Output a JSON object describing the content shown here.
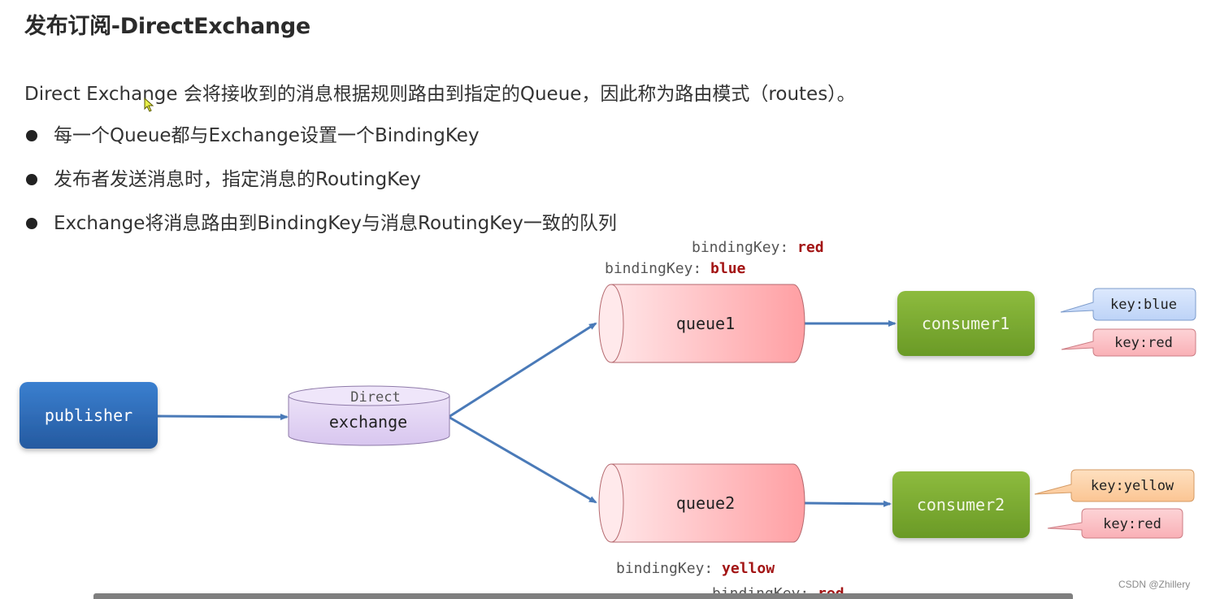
{
  "title": "发布订阅-DirectExchange",
  "intro": "Direct Exchange 会将接收到的消息根据规则路由到指定的Queue，因此称为路由模式（routes）。",
  "bullets": [
    "每一个Queue都与Exchange设置一个BindingKey",
    "发布者发送消息时，指定消息的RoutingKey",
    "Exchange将消息路由到BindingKey与消息RoutingKey一致的队列"
  ],
  "diagram": {
    "publisher": {
      "label": "publisher"
    },
    "exchange": {
      "type_label": "Direct",
      "label": "exchange"
    },
    "queues": [
      {
        "label": "queue1",
        "binding_keys": [
          {
            "prefix": "bindingKey: ",
            "value": "red"
          },
          {
            "prefix": "bindingKey: ",
            "value": "blue"
          }
        ]
      },
      {
        "label": "queue2",
        "binding_keys": [
          {
            "prefix": "bindingKey: ",
            "value": "yellow"
          },
          {
            "prefix": "bindingKey: ",
            "value": "red"
          }
        ]
      }
    ],
    "consumers": [
      {
        "label": "consumer1",
        "keys": [
          {
            "label": "key:blue",
            "color": "blue"
          },
          {
            "label": "key:red",
            "color": "red"
          }
        ]
      },
      {
        "label": "consumer2",
        "keys": [
          {
            "label": "key:yellow",
            "color": "yellow"
          },
          {
            "label": "key:red",
            "color": "red"
          }
        ]
      }
    ],
    "colors": {
      "publisher": "#2f6db5",
      "exchange": "#e3d5f3",
      "queue": "#ffa4a8",
      "consumer": "#7aa830",
      "arrow": "#4a7ab8",
      "binding_value": "#a31515",
      "key_blue": "#cfe0fb",
      "key_red": "#fbc2c6",
      "key_yellow": "#fcd3a9"
    }
  },
  "watermark": "CSDN @Zhillery"
}
